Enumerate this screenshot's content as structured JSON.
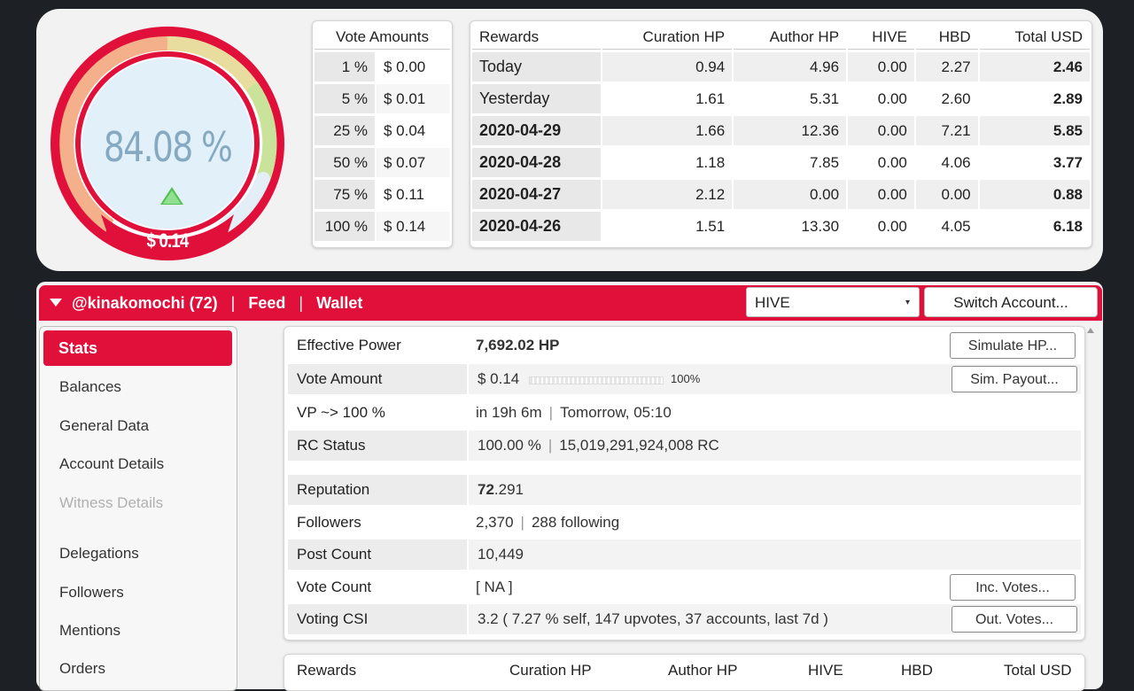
{
  "gauge": {
    "percent_text": "84.08 %",
    "percent_value": 84.08,
    "dollar_text": "$ 0.14",
    "colors": {
      "ring": "#e0103a",
      "arc_green": "#c9e39a",
      "arc_orange": "#f4b08a",
      "inner": "#d9ecf9"
    }
  },
  "vote_amounts": {
    "header": "Vote Amounts",
    "rows": [
      {
        "pct": "1 %",
        "amount": "$ 0.00"
      },
      {
        "pct": "5 %",
        "amount": "$ 0.01"
      },
      {
        "pct": "25 %",
        "amount": "$ 0.04"
      },
      {
        "pct": "50 %",
        "amount": "$ 0.07"
      },
      {
        "pct": "75 %",
        "amount": "$ 0.11"
      },
      {
        "pct": "100 %",
        "amount": "$ 0.14"
      }
    ]
  },
  "rewards": {
    "headers": [
      "Rewards",
      "Curation HP",
      "Author HP",
      "HIVE",
      "HBD",
      "Total USD"
    ],
    "rows": [
      [
        "Today",
        "0.94",
        "4.96",
        "0.00",
        "2.27",
        "2.46"
      ],
      [
        "Yesterday",
        "1.61",
        "5.31",
        "0.00",
        "2.60",
        "2.89"
      ],
      [
        "2020-04-29",
        "1.66",
        "12.36",
        "0.00",
        "7.21",
        "5.85"
      ],
      [
        "2020-04-28",
        "1.18",
        "7.85",
        "0.00",
        "4.06",
        "3.77"
      ],
      [
        "2020-04-27",
        "2.12",
        "0.00",
        "0.00",
        "0.00",
        "0.88"
      ],
      [
        "2020-04-26",
        "1.51",
        "13.30",
        "0.00",
        "4.05",
        "6.18"
      ]
    ]
  },
  "account_bar": {
    "account": "@kinakomochi (72)",
    "sep": "|",
    "feed": "Feed",
    "wallet": "Wallet",
    "currency": "HIVE",
    "switch_label": "Switch Account..."
  },
  "sidebar": {
    "active": "Stats",
    "items": [
      "Balances",
      "General Data",
      "Account Details",
      "Witness Details",
      "Delegations",
      "Followers",
      "Mentions",
      "Orders"
    ]
  },
  "stats": {
    "effective_power": {
      "label": "Effective Power",
      "value": "7,692.02 HP",
      "button": "Simulate HP..."
    },
    "vote_amount": {
      "label": "Vote Amount",
      "value": "$ 0.14",
      "bar_label": "100%",
      "bar_fraction": 1.0,
      "button": "Sim. Payout..."
    },
    "vp": {
      "label": "VP ~> 100 %",
      "value": "in 19h 6m",
      "value2": "Tomorrow, 05:10"
    },
    "rc": {
      "label": "RC Status",
      "value": "100.00 %",
      "value2": "15,019,291,924,008 RC"
    },
    "reputation": {
      "label": "Reputation",
      "value_int": "72",
      "value_dec": ".291"
    },
    "followers": {
      "label": "Followers",
      "value": "2,370",
      "value2": "288 following"
    },
    "post_count": {
      "label": "Post Count",
      "value": "10,449"
    },
    "vote_count": {
      "label": "Vote Count",
      "value": "[ NA ]",
      "button": "Inc. Votes..."
    },
    "voting_csi": {
      "label": "Voting CSI",
      "value": "3.2 ( 7.27 % self, 147 upvotes, 37 accounts, last 7d )",
      "button": "Out. Votes..."
    },
    "separator": "|"
  },
  "rewards2": {
    "headers": [
      "Rewards",
      "Curation HP",
      "Author HP",
      "HIVE",
      "HBD",
      "Total USD"
    ]
  }
}
